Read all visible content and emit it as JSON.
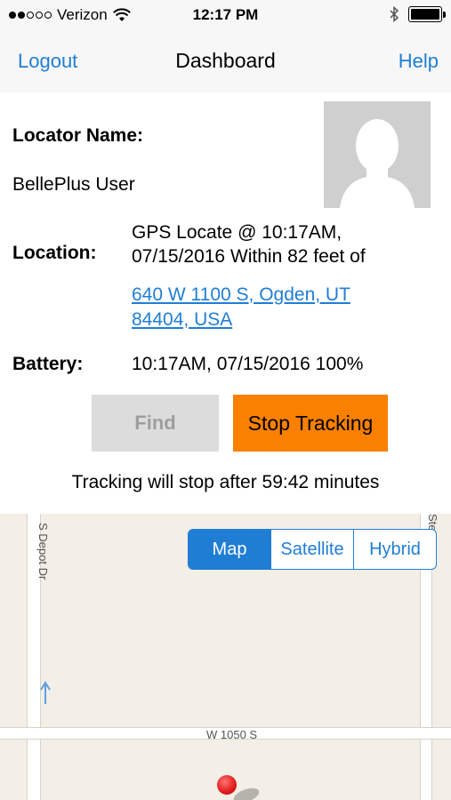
{
  "status_bar": {
    "carrier": "Verizon",
    "time": "12:17 PM"
  },
  "nav": {
    "left": "Logout",
    "title": "Dashboard",
    "right": "Help"
  },
  "locator": {
    "name_label": "Locator Name:",
    "name_value": "BellePlus User",
    "location_label": "Location:",
    "location_text": "GPS Locate @ 10:17AM, 07/15/2016 Within 82 feet of",
    "address_link": "640 W 1100 S, Ogden, UT 84404, USA",
    "battery_label": "Battery:",
    "battery_value": "10:17AM, 07/15/2016 100%"
  },
  "actions": {
    "find": "Find",
    "stop_tracking": "Stop Tracking"
  },
  "tracking_message": "Tracking will stop after 59:42 minutes",
  "map": {
    "segments": [
      "Map",
      "Satellite",
      "Hybrid"
    ],
    "selected": "Map",
    "road_labels": {
      "depot": "S Depot Dr",
      "stewart": "Stewart",
      "w1050": "W 1050 S"
    }
  },
  "colors": {
    "accent": "#1f7ed4",
    "stop_button": "#f98000",
    "find_button": "#dcdcdc"
  },
  "icons": [
    "wifi-icon",
    "bluetooth-icon",
    "battery-icon",
    "avatar-placeholder-icon",
    "map-pin-icon",
    "direction-arrow-icon"
  ]
}
